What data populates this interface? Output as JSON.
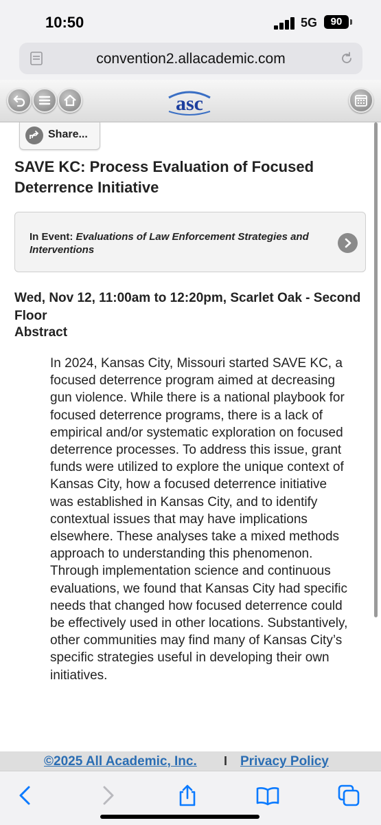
{
  "status": {
    "time": "10:50",
    "network": "5G",
    "battery": "90"
  },
  "browser": {
    "url": "convention2.allacademic.com"
  },
  "site": {
    "logo_text": "asc"
  },
  "share": {
    "label": "Share..."
  },
  "paper": {
    "title": "SAVE KC: Process Evaluation of Focused Deterrence Initiative",
    "event_prefix": "In Event:",
    "event_name": "Evaluations of Law Enforcement Strategies and Interventions",
    "when": "Wed, Nov 12, 11:00am to 12:20pm, Scarlet Oak - Second Floor",
    "abstract_label": "Abstract",
    "abstract": "In 2024, Kansas City, Missouri started SAVE KC, a focused deterrence program aimed at decreasing gun violence. While there is a national playbook for focused deterrence programs, there is a lack of empirical and/or systematic exploration on focused deterrence processes. To address this issue, grant funds were utilized to explore the unique context of Kansas City, how a focused deterrence initiative was established in Kansas City, and to identify contextual issues that may have implications elsewhere. These analyses take a mixed methods approach to understanding this phenomenon. Through implementation science and continuous evaluations, we found that Kansas City had specific needs that changed how focused deterrence could be effectively used in other locations. Substantively, other communities may find many of Kansas City’s specific strategies useful in developing their own initiatives."
  },
  "footer": {
    "copyright": "©2025 All Academic, Inc.",
    "separator": "I",
    "privacy": "Privacy Policy"
  },
  "colors": {
    "link": "#2a6db3",
    "ios_blue": "#0a7aff",
    "logo_blue": "#1d3f9e"
  }
}
